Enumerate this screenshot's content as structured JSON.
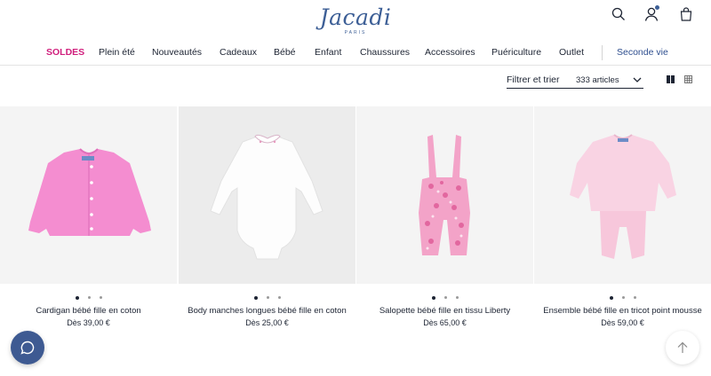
{
  "brand": {
    "name": "Jacadi",
    "subtitle": "PARIS",
    "color": "#3d5f96"
  },
  "header_icons": [
    "search-icon",
    "user-icon",
    "shopping-bag-icon"
  ],
  "nav": {
    "items": [
      "SOLDES",
      "Plein été",
      "Nouveautés",
      "Cadeaux",
      "Bébé",
      "Enfant",
      "Chaussures",
      "Accessoires",
      "Puériculture",
      "Outlet"
    ],
    "secondary": "Seconde vie",
    "highlight_color": "#d01e7c"
  },
  "toolbar": {
    "filter_label": "Filtrer et trier",
    "count_label": "333 articles",
    "views": [
      "grid-large-icon",
      "grid-small-icon"
    ]
  },
  "products": [
    {
      "name": "Cardigan bébé fille en coton",
      "price": "Dès 39,00 €",
      "image": "pink-cardigan"
    },
    {
      "name": "Body manches longues bébé fille en coton",
      "price": "Dès 25,00 €",
      "image": "white-bodysuit"
    },
    {
      "name": "Salopette bébé fille en tissu Liberty",
      "price": "Dès 65,00 €",
      "image": "floral-overalls"
    },
    {
      "name": "Ensemble bébé fille en tricot point mousse",
      "price": "Dès 59,00 €",
      "image": "pink-knit-set"
    }
  ],
  "floating": {
    "chat": "chat-icon",
    "back_to_top": "arrow-up-icon"
  }
}
